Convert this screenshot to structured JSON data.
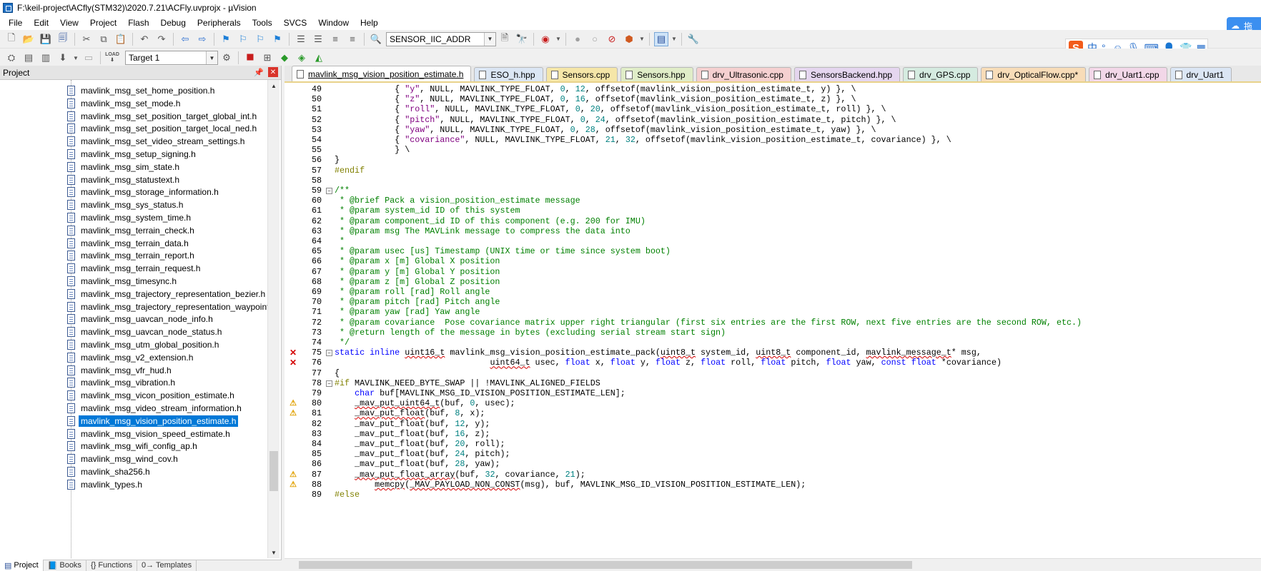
{
  "title": "F:\\keil-project\\ACfly(STM32)\\2020.7.21\\ACFly.uvprojx - µVision",
  "menu": [
    "File",
    "Edit",
    "View",
    "Project",
    "Flash",
    "Debug",
    "Peripherals",
    "Tools",
    "SVCS",
    "Window",
    "Help"
  ],
  "toolbar": {
    "symbol_combo": "SENSOR_IIC_ADDR",
    "target_combo": "Target 1",
    "load_label": "LOAD"
  },
  "ime": {
    "logo": "S",
    "lang": "中",
    "punct": "°,",
    "cloud_label": "拖"
  },
  "project_panel": {
    "title": "Project",
    "files": [
      "mavlink_msg_set_home_position.h",
      "mavlink_msg_set_mode.h",
      "mavlink_msg_set_position_target_global_int.h",
      "mavlink_msg_set_position_target_local_ned.h",
      "mavlink_msg_set_video_stream_settings.h",
      "mavlink_msg_setup_signing.h",
      "mavlink_msg_sim_state.h",
      "mavlink_msg_statustext.h",
      "mavlink_msg_storage_information.h",
      "mavlink_msg_sys_status.h",
      "mavlink_msg_system_time.h",
      "mavlink_msg_terrain_check.h",
      "mavlink_msg_terrain_data.h",
      "mavlink_msg_terrain_report.h",
      "mavlink_msg_terrain_request.h",
      "mavlink_msg_timesync.h",
      "mavlink_msg_trajectory_representation_bezier.h",
      "mavlink_msg_trajectory_representation_waypoints.h",
      "mavlink_msg_uavcan_node_info.h",
      "mavlink_msg_uavcan_node_status.h",
      "mavlink_msg_utm_global_position.h",
      "mavlink_msg_v2_extension.h",
      "mavlink_msg_vfr_hud.h",
      "mavlink_msg_vibration.h",
      "mavlink_msg_vicon_position_estimate.h",
      "mavlink_msg_video_stream_information.h",
      "mavlink_msg_vision_position_estimate.h",
      "mavlink_msg_vision_speed_estimate.h",
      "mavlink_msg_wifi_config_ap.h",
      "mavlink_msg_wind_cov.h",
      "mavlink_sha256.h",
      "mavlink_types.h"
    ],
    "selected_file": "mavlink_msg_vision_position_estimate.h",
    "tabs": [
      "Project",
      "Books",
      "{} Functions",
      "0→ Templates"
    ]
  },
  "editor": {
    "tabs": [
      {
        "label": "mavlink_msg_vision_position_estimate.h",
        "color": "#ffffff",
        "active": true
      },
      {
        "label": "ESO_h.hpp",
        "color": "#dbe6f4",
        "active": false
      },
      {
        "label": "Sensors.cpp",
        "color": "#f5e6a8",
        "active": false
      },
      {
        "label": "Sensors.hpp",
        "color": "#e0edc8",
        "active": false
      },
      {
        "label": "drv_Ultrasonic.cpp",
        "color": "#f5d0d0",
        "active": false
      },
      {
        "label": "SensorsBackend.hpp",
        "color": "#e5d6ef",
        "active": false
      },
      {
        "label": "drv_GPS.cpp",
        "color": "#d5ebe0",
        "active": false
      },
      {
        "label": "drv_OpticalFlow.cpp*",
        "color": "#f8dcb8",
        "active": false
      },
      {
        "label": "drv_Uart1.cpp",
        "color": "#f2d7e8",
        "active": false
      },
      {
        "label": "drv_Uart1",
        "color": "#dbe6f4",
        "active": false
      }
    ],
    "lines": [
      {
        "n": "49",
        "mark": "",
        "html": "            { <span class=\"c-str\">\"y\"</span>, NULL, MAVLINK_TYPE_FLOAT, <span class=\"c-num\">0</span>, <span class=\"c-num\">12</span>, offsetof(mavlink_vision_position_estimate_t, y) }, \\"
      },
      {
        "n": "50",
        "mark": "",
        "html": "            { <span class=\"c-str\">\"z\"</span>, NULL, MAVLINK_TYPE_FLOAT, <span class=\"c-num\">0</span>, <span class=\"c-num\">16</span>, offsetof(mavlink_vision_position_estimate_t, z) }, \\"
      },
      {
        "n": "51",
        "mark": "",
        "html": "            { <span class=\"c-str\">\"roll\"</span>, NULL, MAVLINK_TYPE_FLOAT, <span class=\"c-num\">0</span>, <span class=\"c-num\">20</span>, offsetof(mavlink_vision_position_estimate_t, roll) }, \\"
      },
      {
        "n": "52",
        "mark": "",
        "html": "            { <span class=\"c-str\">\"pitch\"</span>, NULL, MAVLINK_TYPE_FLOAT, <span class=\"c-num\">0</span>, <span class=\"c-num\">24</span>, offsetof(mavlink_vision_position_estimate_t, pitch) }, \\"
      },
      {
        "n": "53",
        "mark": "",
        "html": "            { <span class=\"c-str\">\"yaw\"</span>, NULL, MAVLINK_TYPE_FLOAT, <span class=\"c-num\">0</span>, <span class=\"c-num\">28</span>, offsetof(mavlink_vision_position_estimate_t, yaw) }, \\"
      },
      {
        "n": "54",
        "mark": "",
        "html": "            { <span class=\"c-str\">\"covariance\"</span>, NULL, MAVLINK_TYPE_FLOAT, <span class=\"c-num\">21</span>, <span class=\"c-num\">32</span>, offsetof(mavlink_vision_position_estimate_t, covariance) }, \\"
      },
      {
        "n": "55",
        "mark": "",
        "html": "            } \\"
      },
      {
        "n": "56",
        "mark": "",
        "html": "}"
      },
      {
        "n": "57",
        "mark": "",
        "html": "<span class=\"c-pp\">#endif</span>"
      },
      {
        "n": "58",
        "mark": "",
        "html": ""
      },
      {
        "n": "59",
        "mark": "",
        "html": "<span class=\"c-com\">/**</span>"
      },
      {
        "n": "60",
        "mark": "",
        "html": "<span class=\"c-com\"> * @brief Pack a vision_position_estimate message</span>"
      },
      {
        "n": "61",
        "mark": "",
        "html": "<span class=\"c-com\"> * @param system_id ID of this system</span>"
      },
      {
        "n": "62",
        "mark": "",
        "html": "<span class=\"c-com\"> * @param component_id ID of this component (e.g. 200 for IMU)</span>"
      },
      {
        "n": "63",
        "mark": "",
        "html": "<span class=\"c-com\"> * @param msg The MAVLink message to compress the data into</span>"
      },
      {
        "n": "64",
        "mark": "",
        "html": "<span class=\"c-com\"> *</span>"
      },
      {
        "n": "65",
        "mark": "",
        "html": "<span class=\"c-com\"> * @param usec [us] Timestamp (UNIX time or time since system boot)</span>"
      },
      {
        "n": "66",
        "mark": "",
        "html": "<span class=\"c-com\"> * @param x [m] Global X position</span>"
      },
      {
        "n": "67",
        "mark": "",
        "html": "<span class=\"c-com\"> * @param y [m] Global Y position</span>"
      },
      {
        "n": "68",
        "mark": "",
        "html": "<span class=\"c-com\"> * @param z [m] Global Z position</span>"
      },
      {
        "n": "69",
        "mark": "",
        "html": "<span class=\"c-com\"> * @param roll [rad] Roll angle</span>"
      },
      {
        "n": "70",
        "mark": "",
        "html": "<span class=\"c-com\"> * @param pitch [rad] Pitch angle</span>"
      },
      {
        "n": "71",
        "mark": "",
        "html": "<span class=\"c-com\"> * @param yaw [rad] Yaw angle</span>"
      },
      {
        "n": "72",
        "mark": "",
        "html": "<span class=\"c-com\"> * @param covariance  Pose covariance matrix upper right triangular (first six entries are the first ROW, next five entries are the second ROW, etc.)</span>"
      },
      {
        "n": "73",
        "mark": "",
        "html": "<span class=\"c-com\"> * @return length of the message in bytes (excluding serial stream start sign)</span>"
      },
      {
        "n": "74",
        "mark": "",
        "html": "<span class=\"c-com\"> */</span>"
      },
      {
        "n": "75",
        "mark": "err",
        "html": "<span class=\"c-kw\">static</span> <span class=\"c-kw\">inline</span> <span class=\"squig\">uint16_t</span> mavlink_msg_vision_position_estimate_pack(<span class=\"squig\">uint8_t</span> system_id, <span class=\"squig\">uint8_t</span> component_id, <span class=\"squig\">mavlink_message_t</span>* msg,"
      },
      {
        "n": "76",
        "mark": "err",
        "html": "                               <span class=\"squig\">uint64_t</span> usec, <span class=\"c-kw\">float</span> x, <span class=\"c-kw\">float</span> y, <span class=\"c-kw\">float</span> z, <span class=\"c-kw\">float</span> roll, <span class=\"c-kw\">float</span> pitch, <span class=\"c-kw\">float</span> yaw, <span class=\"c-kw\">const</span> <span class=\"c-kw\">float</span> *covariance)"
      },
      {
        "n": "77",
        "mark": "",
        "html": "{"
      },
      {
        "n": "78",
        "mark": "",
        "html": "<span class=\"c-pp\">#if</span> MAVLINK_NEED_BYTE_SWAP || !MAVLINK_ALIGNED_FIELDS"
      },
      {
        "n": "79",
        "mark": "",
        "html": "    <span class=\"c-kw\">char</span> buf[MAVLINK_MSG_ID_VISION_POSITION_ESTIMATE_LEN];"
      },
      {
        "n": "80",
        "mark": "warn",
        "html": "    <span class=\"squig\">_mav_put_uint64_t</span>(buf, <span class=\"c-num\">0</span>, usec);"
      },
      {
        "n": "81",
        "mark": "warn",
        "html": "    <span class=\"squig\">_mav_put_float</span>(buf, <span class=\"c-num\">8</span>, x);"
      },
      {
        "n": "82",
        "mark": "",
        "html": "    _mav_put_float(buf, <span class=\"c-num\">12</span>, y);"
      },
      {
        "n": "83",
        "mark": "",
        "html": "    _mav_put_float(buf, <span class=\"c-num\">16</span>, z);"
      },
      {
        "n": "84",
        "mark": "",
        "html": "    _mav_put_float(buf, <span class=\"c-num\">20</span>, roll);"
      },
      {
        "n": "85",
        "mark": "",
        "html": "    _mav_put_float(buf, <span class=\"c-num\">24</span>, pitch);"
      },
      {
        "n": "86",
        "mark": "",
        "html": "    _mav_put_float(buf, <span class=\"c-num\">28</span>, yaw);"
      },
      {
        "n": "87",
        "mark": "warn",
        "html": "    <span class=\"squig\">_mav_put_float_array</span>(buf, <span class=\"c-num\">32</span>, covariance, <span class=\"c-num\">21</span>);"
      },
      {
        "n": "88",
        "mark": "warn",
        "html": "        <span class=\"squig\">memcpy</span>(<span class=\"squig\">_MAV_PAYLOAD_NON_CONST</span>(msg), buf, MAVLINK_MSG_ID_VISION_POSITION_ESTIMATE_LEN);"
      },
      {
        "n": "89",
        "mark": "",
        "html": "<span class=\"c-pp\">#else</span>"
      }
    ]
  },
  "colors": {
    "selection": "#0078d7",
    "error_mark": "#d40000",
    "warning_mark": "#e0a000",
    "comment": "#008000",
    "keyword": "#0000ff",
    "string": "#800080"
  }
}
